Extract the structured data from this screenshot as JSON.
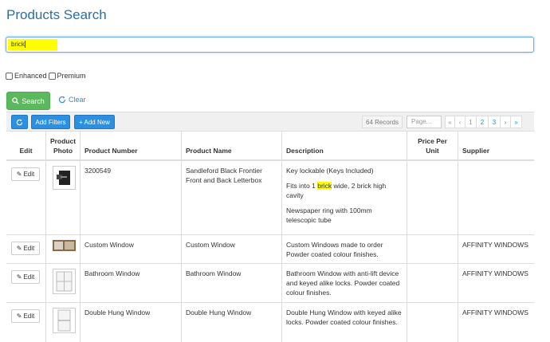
{
  "page": {
    "title": "Products Search"
  },
  "search": {
    "value": "brick",
    "placeholder": ""
  },
  "options": {
    "enhanced": "Enhanced",
    "premium": "Premium"
  },
  "actions": {
    "search_label": "Search",
    "clear_label": "Clear"
  },
  "toolbar": {
    "add_filters": "Add Filters",
    "add_new": "+ Add New",
    "records": "64 Records",
    "page_placeholder": "Page...",
    "pager": [
      "«",
      "‹",
      "1",
      "2",
      "3",
      "›",
      "»"
    ]
  },
  "table": {
    "headers": {
      "edit": "Edit",
      "photo_line1": "Product",
      "photo_line2": "Photo",
      "number": "Product Number",
      "name": "Product Name",
      "description": "Description",
      "price_line1": "Price Per",
      "price_line2": "Unit",
      "supplier": "Supplier"
    },
    "edit_label": "Edit",
    "rows": [
      {
        "number": "3200549",
        "name": "Sandleford Black Frontier Front and Back Letterbox",
        "desc": {
          "p1": "Key lockable (Keys Included)",
          "p2_pre": "Fits into 1 ",
          "p2_hl": "brick",
          "p2_post": " wide, 2 brick high cavity",
          "p3": "Newspaper ring with 100mm telescopic tube"
        },
        "price": "",
        "supplier": ""
      },
      {
        "number": "Custom Window",
        "name": "Custom Window",
        "desc": "Custom Windows made to order Powder coated colour finishes.",
        "price": "",
        "supplier": "AFFINITY WINDOWS"
      },
      {
        "number": "Bathroom Window",
        "name": "Bathroom Window",
        "desc": "Bathroom Window with anti-lift device and keyed alike locks. Powder coated colour finishes.",
        "price": "",
        "supplier": "AFFINITY WINDOWS"
      },
      {
        "number": "Double Hung Window",
        "name": "Double Hung Window",
        "desc": "Double Hung Window with keyed alike locks. Powder coated colour finishes.",
        "price": "",
        "supplier": "AFFINITY WINDOWS"
      }
    ]
  },
  "colors": {
    "accent": "#2d8fe0",
    "success": "#5cb85c",
    "title": "#2a6fa8",
    "highlight": "#ffff00"
  }
}
